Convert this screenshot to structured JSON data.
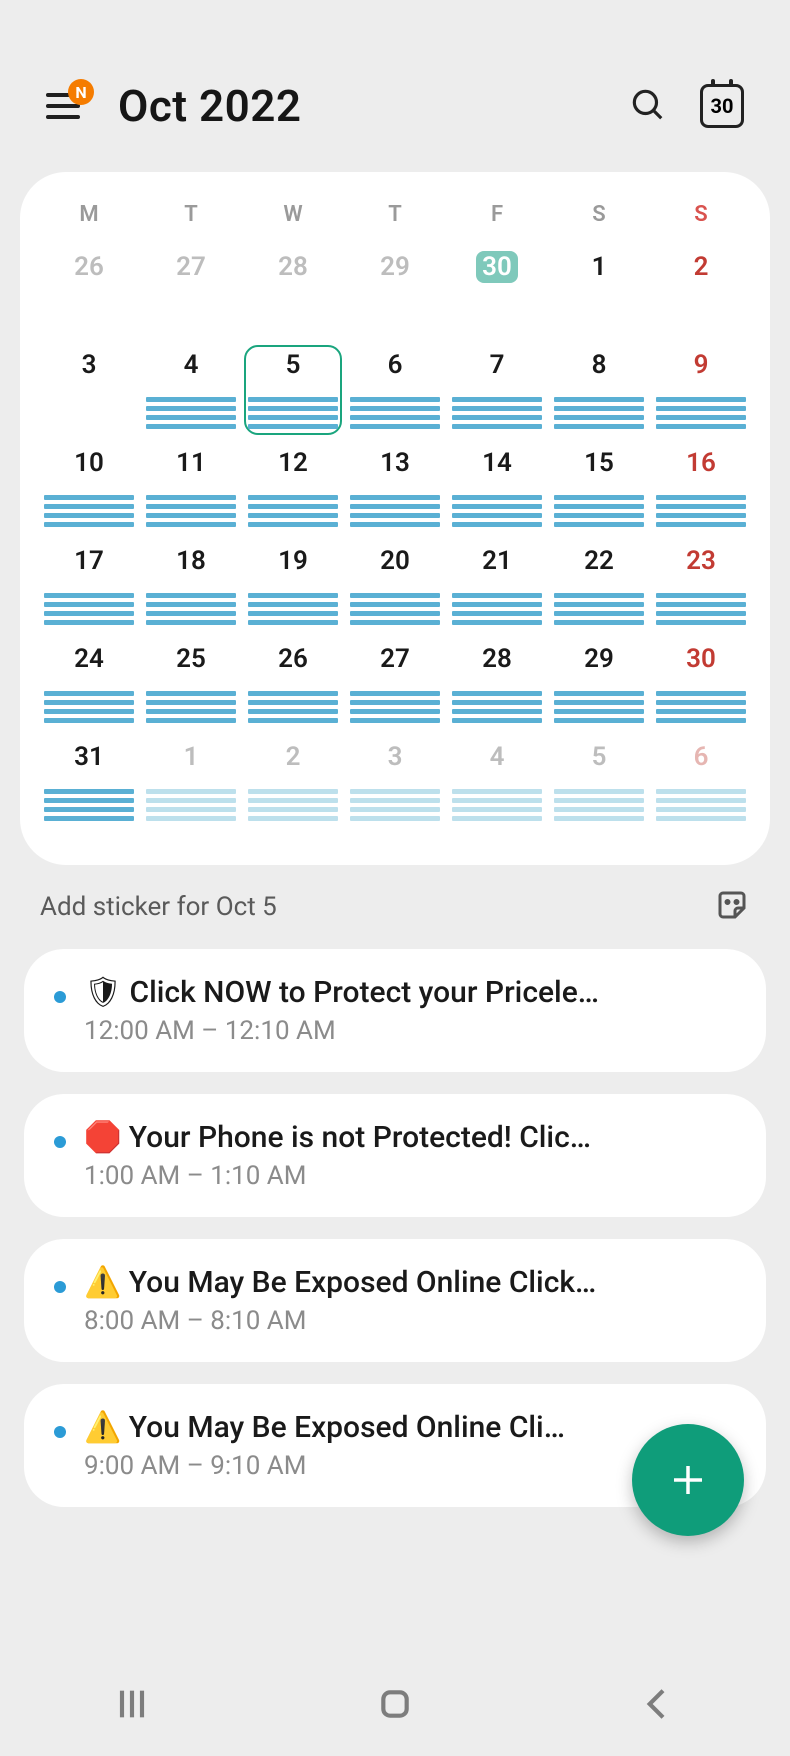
{
  "header": {
    "title": "Oct  2022",
    "badge": "N",
    "today_number": "30"
  },
  "dow": [
    "M",
    "T",
    "W",
    "T",
    "F",
    "S",
    "S"
  ],
  "weeks": [
    [
      {
        "n": "26",
        "cls": "prev",
        "bars": 0
      },
      {
        "n": "27",
        "cls": "prev",
        "bars": 0
      },
      {
        "n": "28",
        "cls": "prev",
        "bars": 0
      },
      {
        "n": "29",
        "cls": "prev",
        "bars": 0
      },
      {
        "n": "30",
        "cls": "prev today",
        "bars": 0
      },
      {
        "n": "1",
        "cls": "",
        "bars": 0
      },
      {
        "n": "2",
        "cls": "sun",
        "bars": 0
      }
    ],
    [
      {
        "n": "3",
        "cls": "",
        "bars": 0
      },
      {
        "n": "4",
        "cls": "",
        "bars": 4
      },
      {
        "n": "5",
        "cls": "selected",
        "bars": 4
      },
      {
        "n": "6",
        "cls": "",
        "bars": 4
      },
      {
        "n": "7",
        "cls": "",
        "bars": 4
      },
      {
        "n": "8",
        "cls": "",
        "bars": 4
      },
      {
        "n": "9",
        "cls": "sun",
        "bars": 4
      }
    ],
    [
      {
        "n": "10",
        "cls": "",
        "bars": 4
      },
      {
        "n": "11",
        "cls": "",
        "bars": 4
      },
      {
        "n": "12",
        "cls": "",
        "bars": 4
      },
      {
        "n": "13",
        "cls": "",
        "bars": 4
      },
      {
        "n": "14",
        "cls": "",
        "bars": 4
      },
      {
        "n": "15",
        "cls": "",
        "bars": 4
      },
      {
        "n": "16",
        "cls": "sun",
        "bars": 4
      }
    ],
    [
      {
        "n": "17",
        "cls": "",
        "bars": 4
      },
      {
        "n": "18",
        "cls": "",
        "bars": 4
      },
      {
        "n": "19",
        "cls": "",
        "bars": 4
      },
      {
        "n": "20",
        "cls": "",
        "bars": 4
      },
      {
        "n": "21",
        "cls": "",
        "bars": 4
      },
      {
        "n": "22",
        "cls": "",
        "bars": 4
      },
      {
        "n": "23",
        "cls": "sun",
        "bars": 4
      }
    ],
    [
      {
        "n": "24",
        "cls": "",
        "bars": 4
      },
      {
        "n": "25",
        "cls": "",
        "bars": 4
      },
      {
        "n": "26",
        "cls": "",
        "bars": 4
      },
      {
        "n": "27",
        "cls": "",
        "bars": 4
      },
      {
        "n": "28",
        "cls": "",
        "bars": 4
      },
      {
        "n": "29",
        "cls": "",
        "bars": 4
      },
      {
        "n": "30",
        "cls": "sun",
        "bars": 4
      }
    ],
    [
      {
        "n": "31",
        "cls": "",
        "bars": 4
      },
      {
        "n": "1",
        "cls": "next",
        "bars": 4
      },
      {
        "n": "2",
        "cls": "next",
        "bars": 4
      },
      {
        "n": "3",
        "cls": "next",
        "bars": 4
      },
      {
        "n": "4",
        "cls": "next",
        "bars": 4
      },
      {
        "n": "5",
        "cls": "next",
        "bars": 4
      },
      {
        "n": "6",
        "cls": "next sun",
        "bars": 4
      }
    ]
  ],
  "sticker_label": "Add sticker for Oct 5",
  "events": [
    {
      "title": "🛡 Click NOW to Protect your Pricele…",
      "time": "12:00 AM – 12:10 AM"
    },
    {
      "title": "🛑 Your Phone is not Protected! Clic…",
      "time": "1:00 AM – 1:10 AM"
    },
    {
      "title": "⚠️ You May Be Exposed Online  Click…",
      "time": "8:00 AM – 8:10 AM"
    },
    {
      "title": "⚠️ You May Be Exposed Online  Cli…",
      "time": "9:00 AM – 9:10 AM"
    }
  ]
}
